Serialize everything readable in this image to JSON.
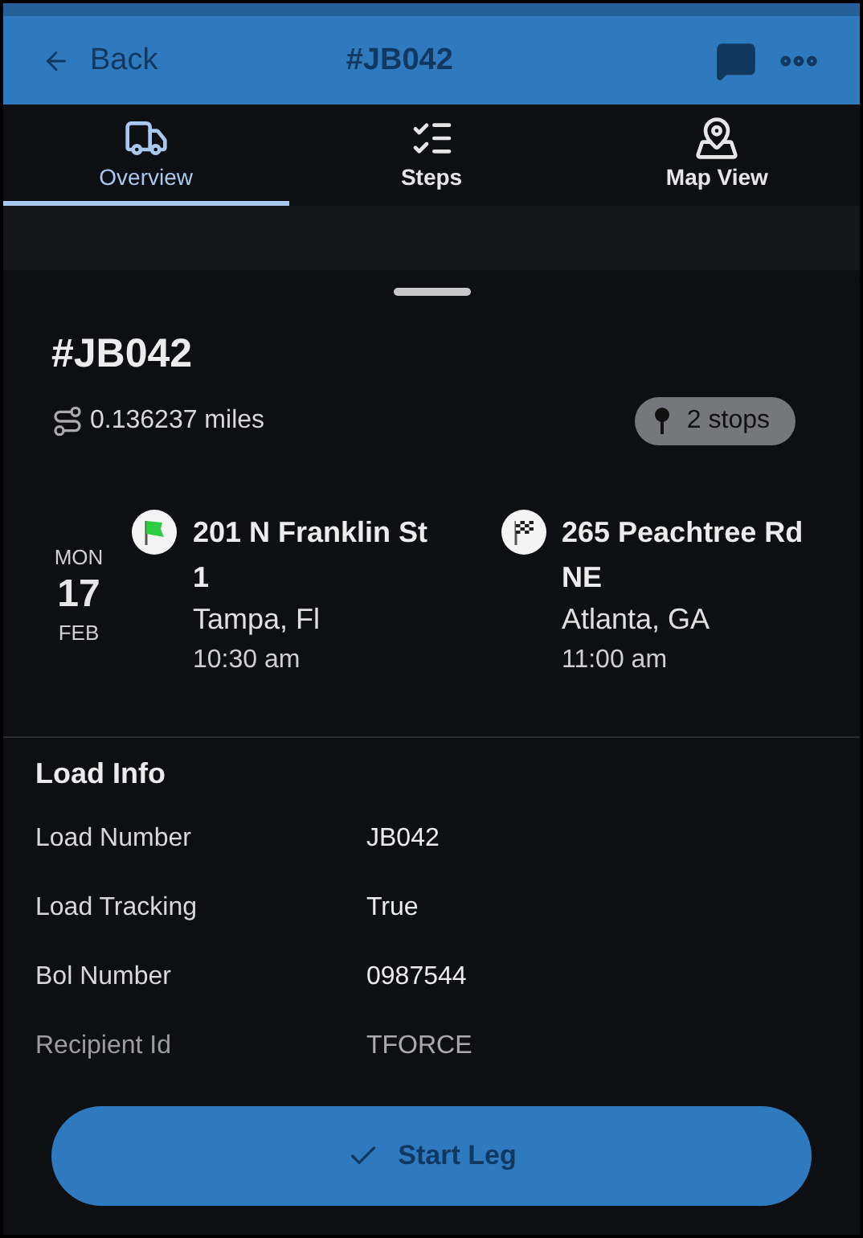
{
  "header": {
    "back": "Back",
    "title": "#JB042"
  },
  "tabs": [
    {
      "label": "Overview",
      "selected": true,
      "kind": "truck"
    },
    {
      "label": "Steps",
      "selected": false,
      "kind": "checklist"
    },
    {
      "label": "Map View",
      "selected": false,
      "kind": "map"
    }
  ],
  "job": {
    "title": "#JB042",
    "distance": "0.136237 miles",
    "stops_badge": "2 stops"
  },
  "date": {
    "weekday": "MON",
    "day": "17",
    "month": "FEB"
  },
  "stops": [
    {
      "kind": "start",
      "address": "201 N Franklin St 1",
      "city": "Tampa, Fl",
      "time": "10:30 am"
    },
    {
      "kind": "finish",
      "address": "265 Peachtree Rd NE",
      "city": "Atlanta, GA",
      "time": "11:00 am"
    }
  ],
  "load_info": {
    "title": "Load Info",
    "rows": [
      {
        "label": "Load Number",
        "value": "JB042",
        "faded": false
      },
      {
        "label": "Load Tracking",
        "value": "True",
        "faded": false
      },
      {
        "label": "Bol Number",
        "value": "0987544",
        "faded": false
      },
      {
        "label": "Recipient Id",
        "value": "TFORCE",
        "faded": true
      }
    ]
  },
  "action": {
    "label": "Start Leg"
  }
}
